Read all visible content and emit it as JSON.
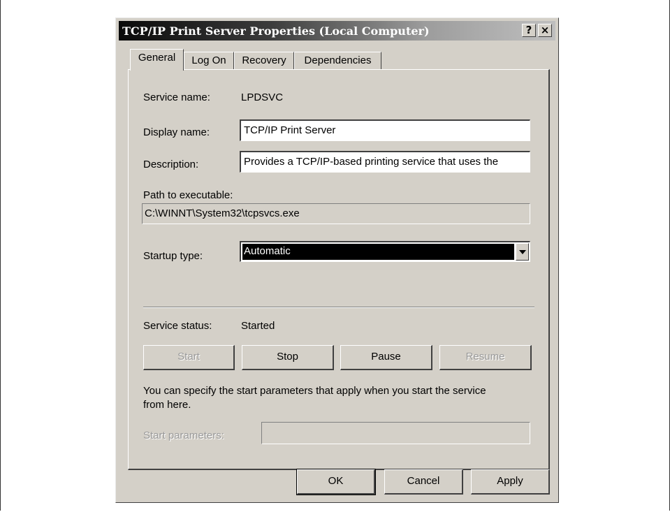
{
  "window": {
    "title": "TCP/IP Print Server Properties (Local Computer)",
    "help_button": "?",
    "close_button": "×"
  },
  "tabs": [
    {
      "label": "General",
      "active": true
    },
    {
      "label": "Log On",
      "active": false
    },
    {
      "label": "Recovery",
      "active": false
    },
    {
      "label": "Dependencies",
      "active": false
    }
  ],
  "general": {
    "service_name_label": "Service name:",
    "service_name_value": "LPDSVC",
    "display_name_label": "Display name:",
    "display_name_value": "TCP/IP Print Server",
    "description_label": "Description:",
    "description_value": "Provides a TCP/IP-based printing service that uses the",
    "path_label": "Path to executable:",
    "path_value": "C:\\WINNT\\System32\\tcpsvcs.exe",
    "startup_type_label": "Startup type:",
    "startup_type_value": "Automatic",
    "service_status_label": "Service status:",
    "service_status_value": "Started",
    "buttons": {
      "start": "Start",
      "stop": "Stop",
      "pause": "Pause",
      "resume": "Resume"
    },
    "hint_line1": "You can specify the start parameters that apply when you start the service",
    "hint_line2": "from here.",
    "start_params_label": "Start parameters:",
    "start_params_value": ""
  },
  "footer": {
    "ok": "OK",
    "cancel": "Cancel",
    "apply": "Apply"
  },
  "colors": {
    "dialog_face": "#d4d0c8",
    "titlebar_start": "#0a0a0a",
    "titlebar_end": "#bfbfbf",
    "selection": "#000000",
    "disabled_text": "#9a9a9a"
  }
}
